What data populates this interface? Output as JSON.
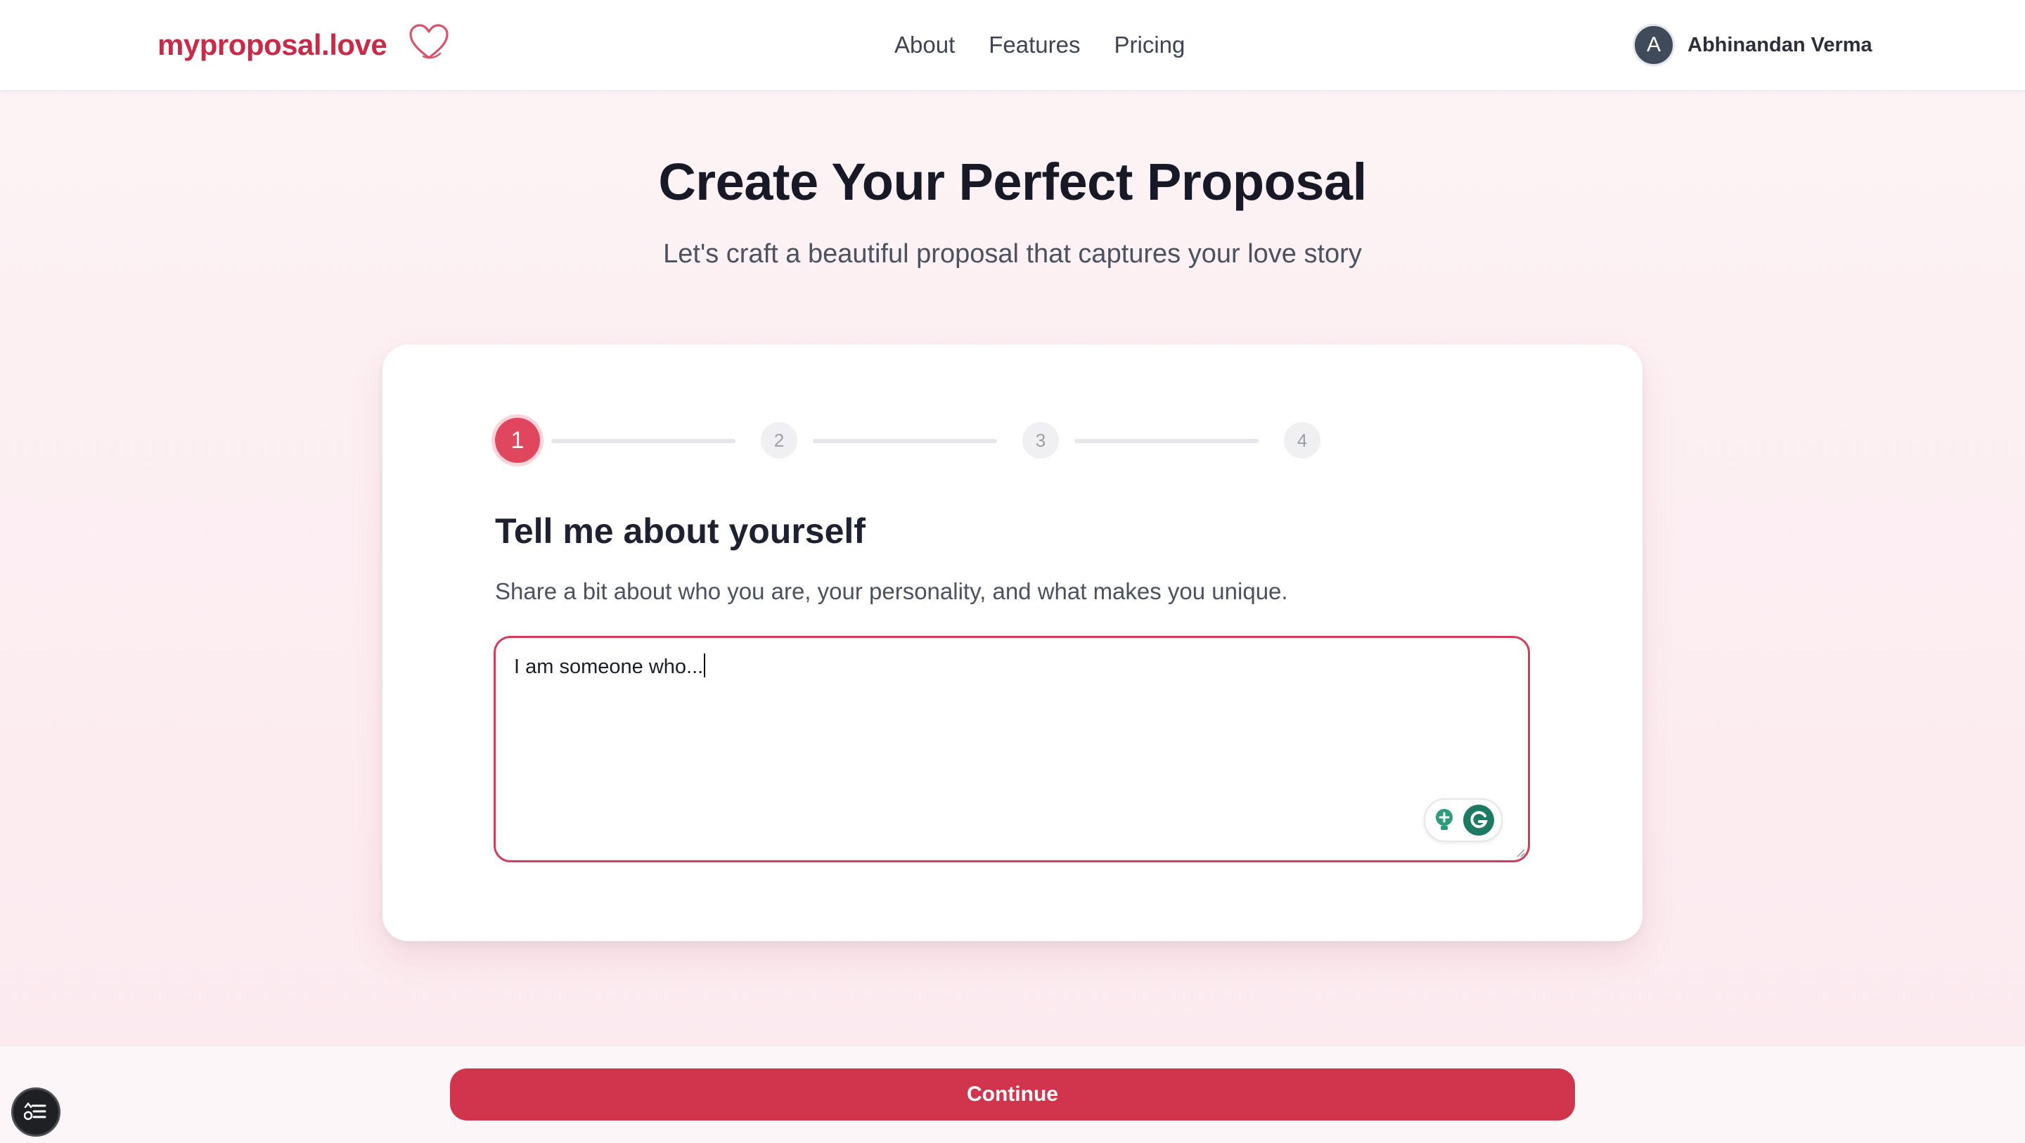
{
  "header": {
    "logo_text": "myproposal.love",
    "nav": [
      "About",
      "Features",
      "Pricing"
    ],
    "user": {
      "avatar_initial": "A",
      "name": "Abhinandan Verma"
    }
  },
  "hero": {
    "title": "Create Your Perfect Proposal",
    "subtitle": "Let's craft a beautiful proposal that captures your love story"
  },
  "stepper": {
    "steps": [
      "1",
      "2",
      "3",
      "4"
    ],
    "current_step": 1
  },
  "question": {
    "title": "Tell me about yourself",
    "description": "Share a bit about who you are, your personality, and what makes you unique.",
    "input_value": "I am someone who..."
  },
  "footer": {
    "continue_label": "Continue"
  },
  "colors": {
    "brand": "#c92a48",
    "accent": "#e0465e",
    "button": "#d0354d",
    "grammarly": "#1d7a62"
  },
  "icons": {
    "logo": "heart-outline-icon",
    "grammarly": "grammarly-icon",
    "suggestion": "lightbulb-icon",
    "fab": "checklist-icon"
  }
}
